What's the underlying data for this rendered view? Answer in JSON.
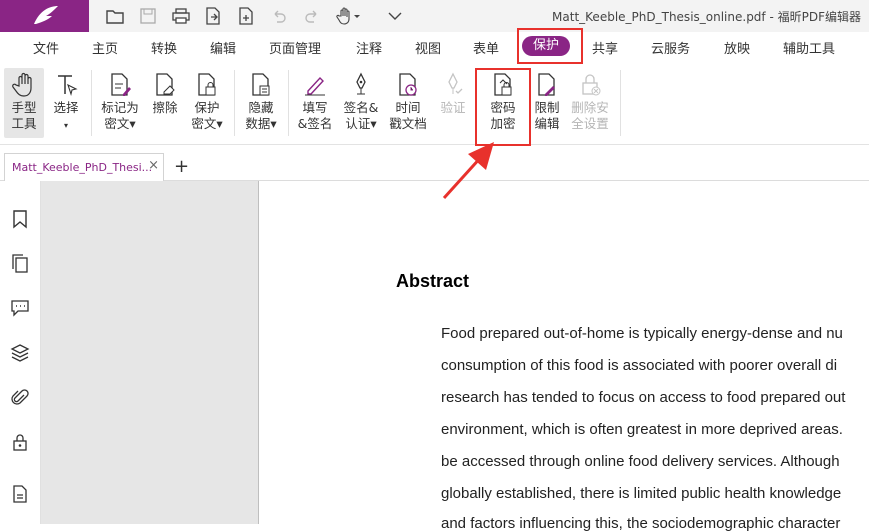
{
  "app": {
    "title": "Matt_Keeble_PhD_Thesis_online.pdf - 福昕PDF编辑器",
    "brand_color": "#8a2585"
  },
  "quick_access": [
    "open-folder-icon",
    "save-icon",
    "print-icon",
    "export-icon",
    "new-doc-icon",
    "undo-icon",
    "redo-icon",
    "hand-tool-icon",
    "customize-dropdown-icon"
  ],
  "menu": {
    "items": [
      "文件",
      "主页",
      "转换",
      "编辑",
      "页面管理",
      "注释",
      "视图",
      "表单",
      "保护",
      "共享",
      "云服务",
      "放映",
      "辅助工具"
    ],
    "active": "保护"
  },
  "ribbon": {
    "hand": {
      "l1": "手型",
      "l2": "工具"
    },
    "select": {
      "l1": "选择",
      "l2": "▾"
    },
    "mark_redact": {
      "l1": "标记为",
      "l2": "密文▾"
    },
    "erase": {
      "l1": "擦除"
    },
    "protect_redact": {
      "l1": "保护",
      "l2": "密文▾"
    },
    "hide_data": {
      "l1": "隐藏",
      "l2": "数据▾"
    },
    "fill_sign": {
      "l1": "填写",
      "l2": "&签名"
    },
    "sign_cert": {
      "l1": "签名&",
      "l2": "认证▾"
    },
    "timestamp": {
      "l1": "时间",
      "l2": "戳文档"
    },
    "verify": {
      "l1": "验证"
    },
    "password_encrypt": {
      "l1": "密码",
      "l2": "加密"
    },
    "restrict_edit": {
      "l1": "限制",
      "l2": "编辑"
    },
    "remove_security": {
      "l1": "删除安",
      "l2": "全设置"
    }
  },
  "tabs": {
    "doc_tab": "Matt_Keeble_PhD_Thesi...",
    "close": "×",
    "add": "+"
  },
  "left_panel": [
    "bookmark-icon",
    "pages-icon",
    "comment-icon",
    "layers-icon",
    "attachment-icon",
    "security-icon",
    "document-properties-icon"
  ],
  "document": {
    "heading": "Abstract",
    "lines": [
      "Food prepared out-of-home is typically energy-dense and nu",
      "consumption of this food is associated with poorer overall di",
      "research has tended to focus on access to food prepared out",
      "environment, which is often greatest in more deprived areas.",
      "be accessed through online food delivery services. Although",
      "globally established, there is limited public health knowledge",
      "and factors influencing this, the sociodemographic character"
    ]
  },
  "annotation": {
    "color": "#e8312c"
  }
}
